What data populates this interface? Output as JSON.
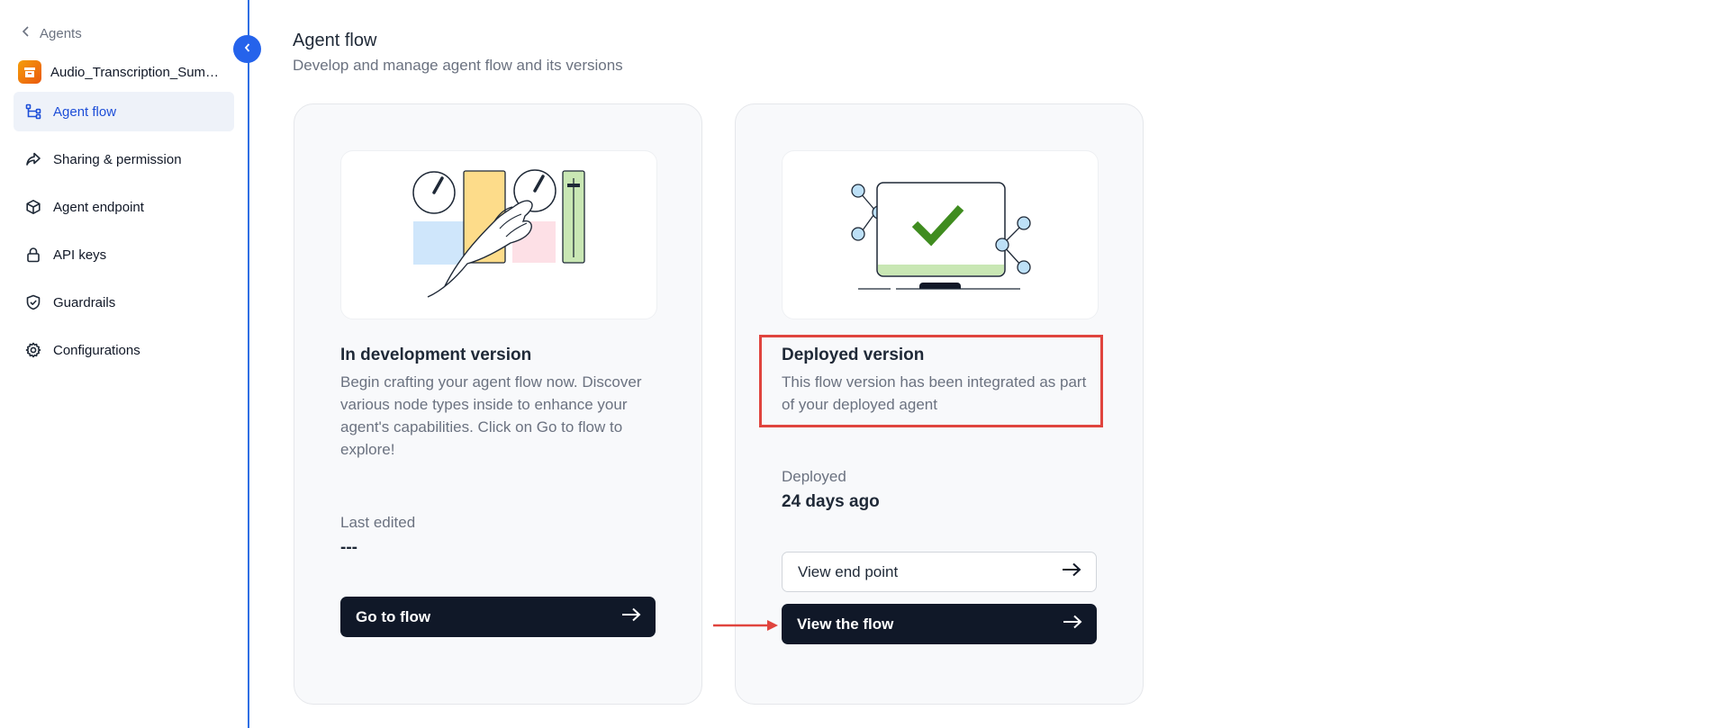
{
  "sidebar": {
    "back_label": "Agents",
    "agent_name": "Audio_Transcription_Summarizer",
    "items": [
      {
        "label": "Agent flow",
        "icon": "flow-icon",
        "active": true
      },
      {
        "label": "Sharing & permission",
        "icon": "share-icon",
        "active": false
      },
      {
        "label": "Agent endpoint",
        "icon": "cube-icon",
        "active": false
      },
      {
        "label": "API keys",
        "icon": "lock-icon",
        "active": false
      },
      {
        "label": "Guardrails",
        "icon": "shield-icon",
        "active": false
      },
      {
        "label": "Configurations",
        "icon": "gear-icon",
        "active": false
      }
    ]
  },
  "header": {
    "title": "Agent flow",
    "subtitle": "Develop and manage agent flow and its versions"
  },
  "dev_card": {
    "title": "In development version",
    "description": "Begin crafting your agent flow now. Discover various node types inside to enhance your agent's capabilities. Click on Go to flow to explore!",
    "meta_label": "Last edited",
    "meta_value": "---",
    "button_label": "Go to flow",
    "illustration": "hand-controls-illustration"
  },
  "deployed_card": {
    "title": "Deployed version",
    "description": "This flow version has been integrated as part of your deployed agent",
    "meta_label": "Deployed",
    "meta_value": "24 days ago",
    "endpoint_button_label": "View end point",
    "flow_button_label": "View the flow",
    "illustration": "monitor-checkmark-illustration"
  },
  "colors": {
    "accent": "#2563eb",
    "active_nav_bg": "#eef2f9",
    "dark_button": "#101828",
    "annotation": "#e0443e"
  }
}
